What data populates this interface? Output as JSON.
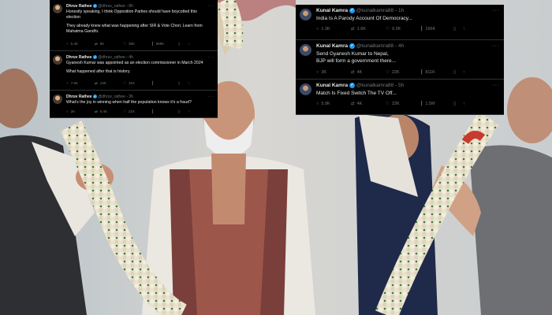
{
  "left_panel": {
    "tweets": [
      {
        "name": "Dhruv Rathee",
        "handle": "@dhruv_rathee",
        "time": "8h",
        "lines": [
          "Honestly speaking, I think Opposition Parties should have boycotted this",
          "election",
          "",
          "They already knew what was happening after SIR & Vote Chori. Learn from",
          "Mahatma Gandhi."
        ],
        "stats": {
          "replies": "5.4K",
          "reposts": "9K",
          "likes": "35K",
          "views": "969K"
        }
      },
      {
        "name": "Dhruv Rathee",
        "handle": "@dhruv_rathee",
        "time": "4h",
        "lines": [
          "Gyanesh Kumar was appointed as an election commissioner in March 2024",
          "",
          "What happened after that is history."
        ],
        "stats": {
          "replies": "7.6K",
          "reposts": "13K",
          "likes": "31K",
          "views": ""
        }
      },
      {
        "name": "Dhruv Rathee",
        "handle": "@dhruv_rathee",
        "time": "3h",
        "lines": [
          "What's the joy in winning when half the population knows it's a fraud?"
        ],
        "stats": {
          "replies": "2K",
          "reposts": "5.4K",
          "likes": "21K",
          "views": ""
        }
      }
    ]
  },
  "right_panel": {
    "tweets": [
      {
        "name": "Kunal Kamra",
        "handle": "@kunalkamra88",
        "time": "1h",
        "lines": [
          "India Is A Parody Account Of Democracy..."
        ],
        "stats": {
          "replies": "1.3K",
          "reposts": "1.6K",
          "likes": "9.3K",
          "views": "156K"
        }
      },
      {
        "name": "Kunal Kamra",
        "handle": "@kunalkamra88",
        "time": "4h",
        "lines": [
          "Send Gyanesh Kumar to Nepal,",
          "BJP will form a government there..."
        ],
        "stats": {
          "replies": "3K",
          "reposts": "4K",
          "likes": "22K",
          "views": "811K"
        }
      },
      {
        "name": "Kunal Kamra",
        "handle": "@kunalkamra88",
        "time": "5h",
        "lines": [
          "Match Is Fixed Switch The TV Off..."
        ],
        "stats": {
          "replies": "5.9K",
          "reposts": "4K",
          "likes": "22K",
          "views": "1.5M"
        }
      }
    ]
  },
  "icons": {
    "reply": "reply-icon",
    "repost": "repost-icon",
    "like": "like-icon",
    "views": "views-icon",
    "bookmark": "bookmark-icon",
    "share": "share-icon",
    "verified": "verified-badge-icon",
    "more": "more-icon"
  },
  "colors": {
    "panel_bg": "#000000",
    "text": "#e7e9ea",
    "muted": "#71767b",
    "verified": "#1d9bf0",
    "divider": "#2f3336"
  }
}
